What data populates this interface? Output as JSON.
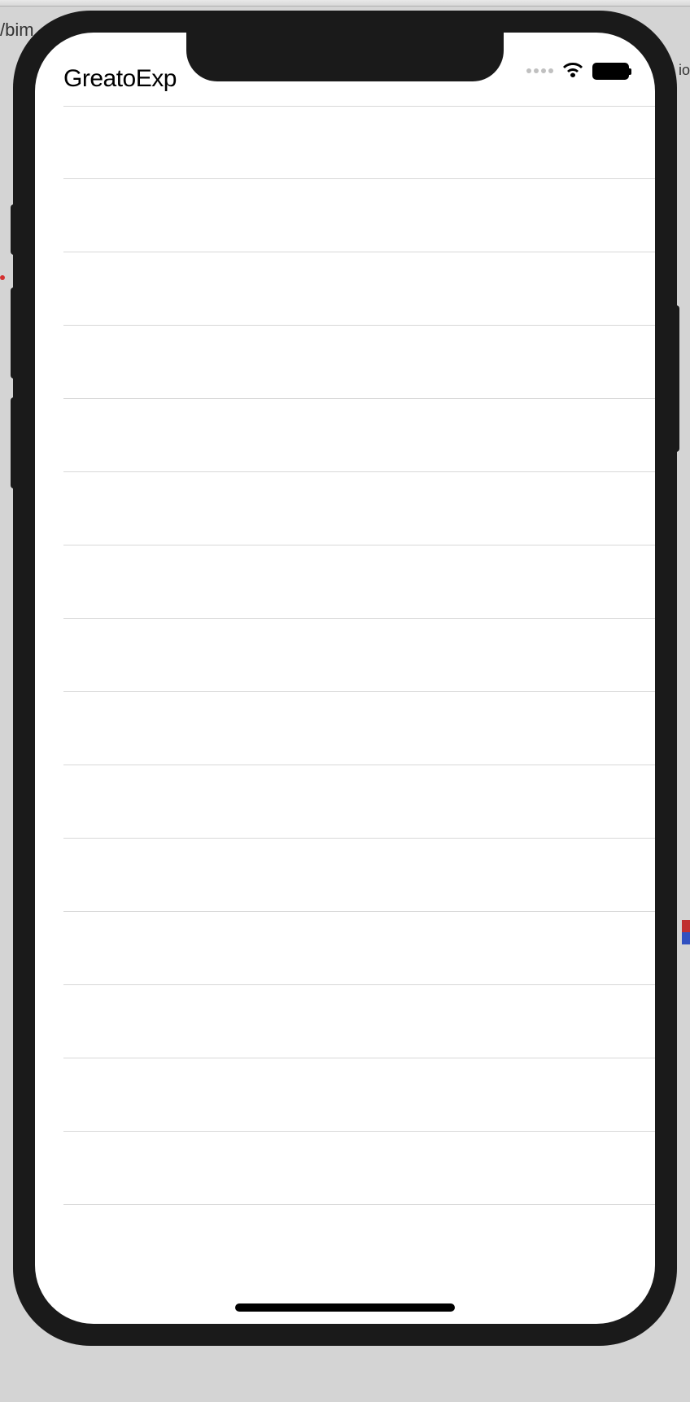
{
  "browser": {
    "url_fragment": "/bim",
    "right_fragment": "io"
  },
  "status_bar": {
    "signal_strength": 0,
    "wifi_connected": true,
    "battery_level": 100
  },
  "header": {
    "title_overlapped": "GreatoExp"
  },
  "list": {
    "row_count": 16
  }
}
